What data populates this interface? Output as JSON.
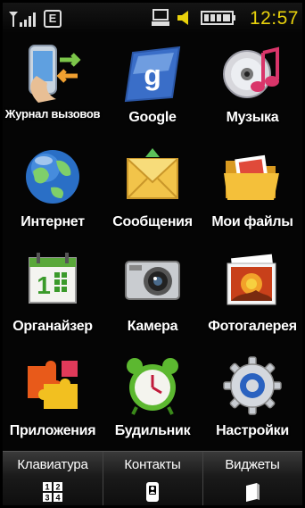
{
  "status_bar": {
    "network_type": "E",
    "time": "12:57",
    "icons": [
      "signal-strength-icon",
      "network-e-icon",
      "pc-connection-icon",
      "volume-icon",
      "battery-icon"
    ]
  },
  "apps": [
    {
      "label": "Журнал вызовов",
      "icon": "call-log-icon"
    },
    {
      "label": "Google",
      "icon": "google-icon"
    },
    {
      "label": "Музыка",
      "icon": "music-icon"
    },
    {
      "label": "Интернет",
      "icon": "globe-icon"
    },
    {
      "label": "Сообщения",
      "icon": "envelope-icon"
    },
    {
      "label": "Мои файлы",
      "icon": "folder-icon"
    },
    {
      "label": "Органайзер",
      "icon": "calendar-icon"
    },
    {
      "label": "Камера",
      "icon": "camera-icon"
    },
    {
      "label": "Фотогалерея",
      "icon": "photo-gallery-icon"
    },
    {
      "label": "Приложения",
      "icon": "puzzle-icon"
    },
    {
      "label": "Будильник",
      "icon": "alarm-clock-icon"
    },
    {
      "label": "Настройки",
      "icon": "gear-icon"
    }
  ],
  "bottom_bar": {
    "keypad": {
      "label": "Клавиатура",
      "icon": "keypad-icon"
    },
    "contacts": {
      "label": "Контакты",
      "icon": "contacts-icon"
    },
    "widgets": {
      "label": "Виджеты",
      "icon": "widgets-icon"
    }
  },
  "colors": {
    "time": "#e9d20c",
    "background": "#050505"
  }
}
